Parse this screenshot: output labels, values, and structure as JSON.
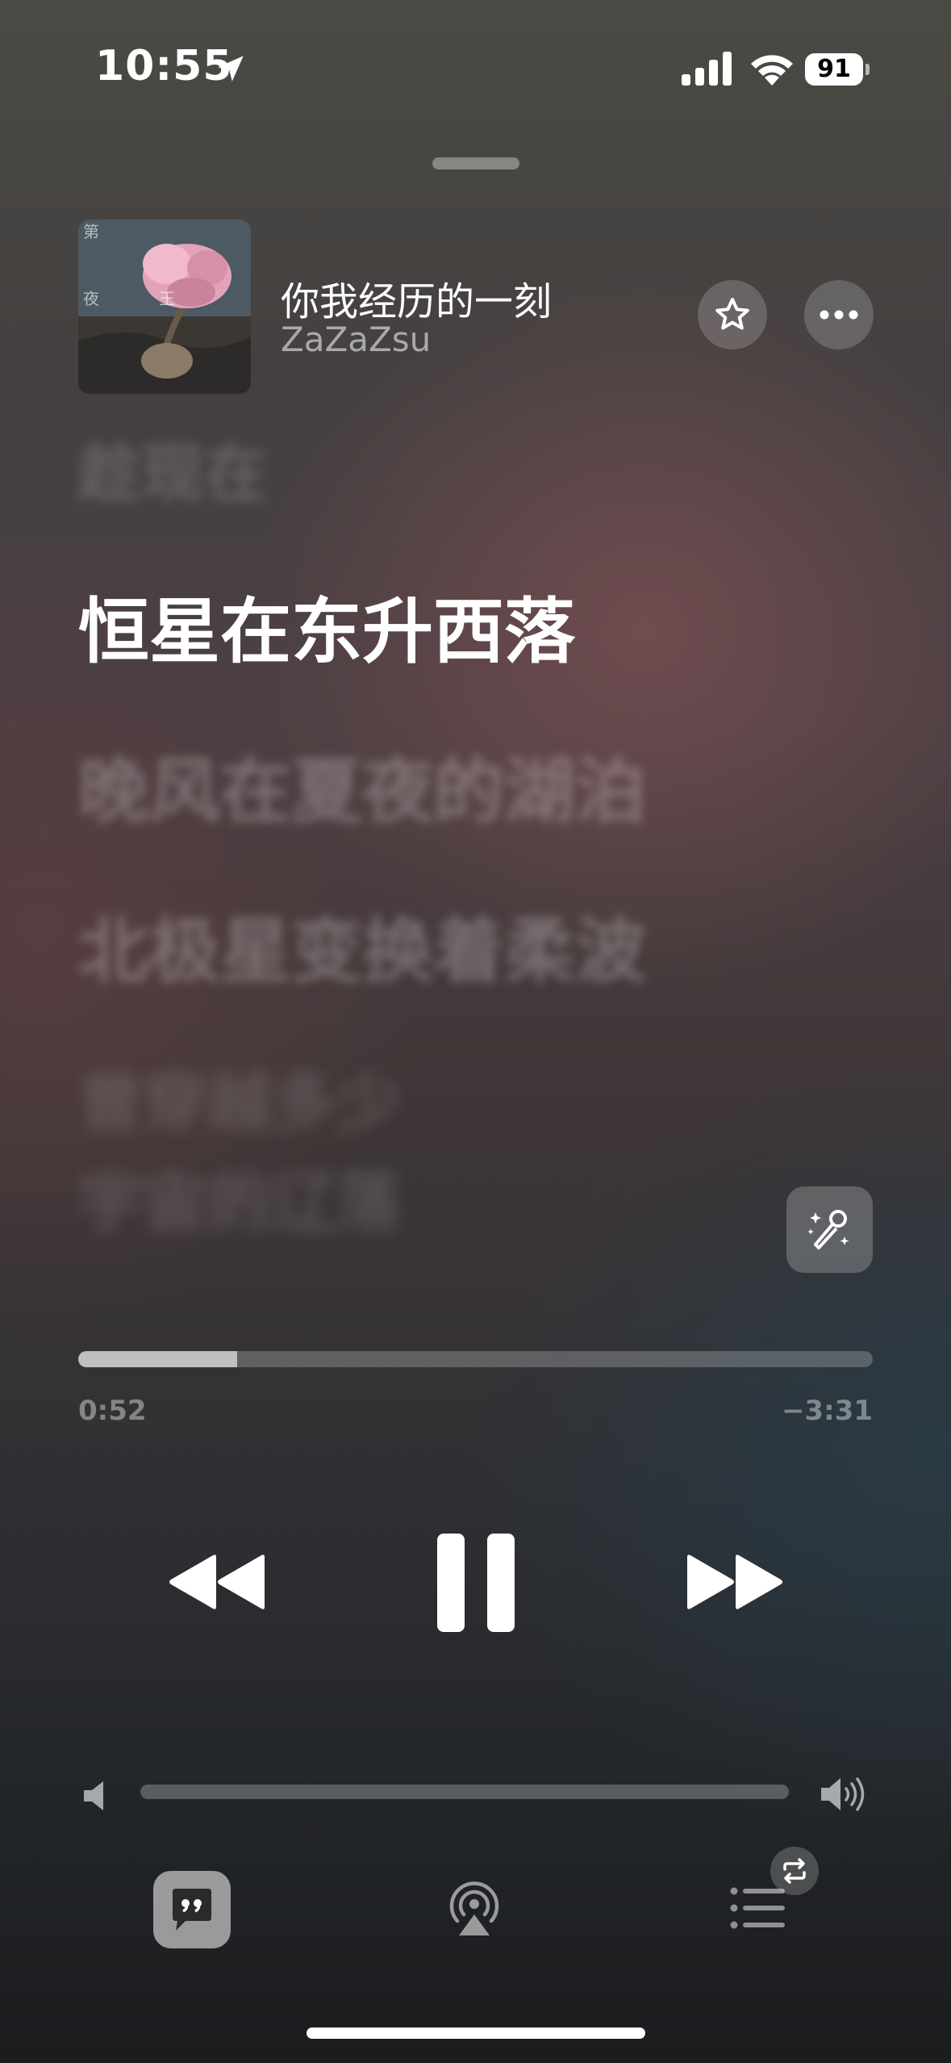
{
  "status_bar": {
    "time": "10:55",
    "battery": "91",
    "location_icon": "location-arrow-icon",
    "signal_icon": "cellular-signal-icon",
    "wifi_icon": "wifi-icon"
  },
  "now_playing": {
    "title": "你我经历的一刻",
    "artist": "ZaZaZsu",
    "artwork_icon": "album-artwork"
  },
  "lyrics": {
    "previous": "趁现在",
    "current": "恒星在东升西落",
    "next": [
      "晚风在夏夜的湖泊",
      "北极星变换着柔波"
    ],
    "upcoming": [
      "曾穿越多少",
      "宇宙的辽落"
    ]
  },
  "progress": {
    "elapsed": "0:52",
    "remaining": "−3:31",
    "fraction": 0.2
  },
  "volume": {
    "level": 0.0
  },
  "colors": {
    "accent": "#ffffff",
    "muted_text": "rgba(255,255,255,0.55)"
  },
  "icons": {
    "favorite": "star-icon",
    "more": "ellipsis-icon",
    "karaoke": "sing-microphone-icon",
    "rewind": "rewind-icon",
    "pause": "pause-icon",
    "forward": "fast-forward-icon",
    "lyrics": "lyrics-quote-icon",
    "airplay": "airplay-icon",
    "queue": "queue-list-icon",
    "repeat": "repeat-icon"
  }
}
